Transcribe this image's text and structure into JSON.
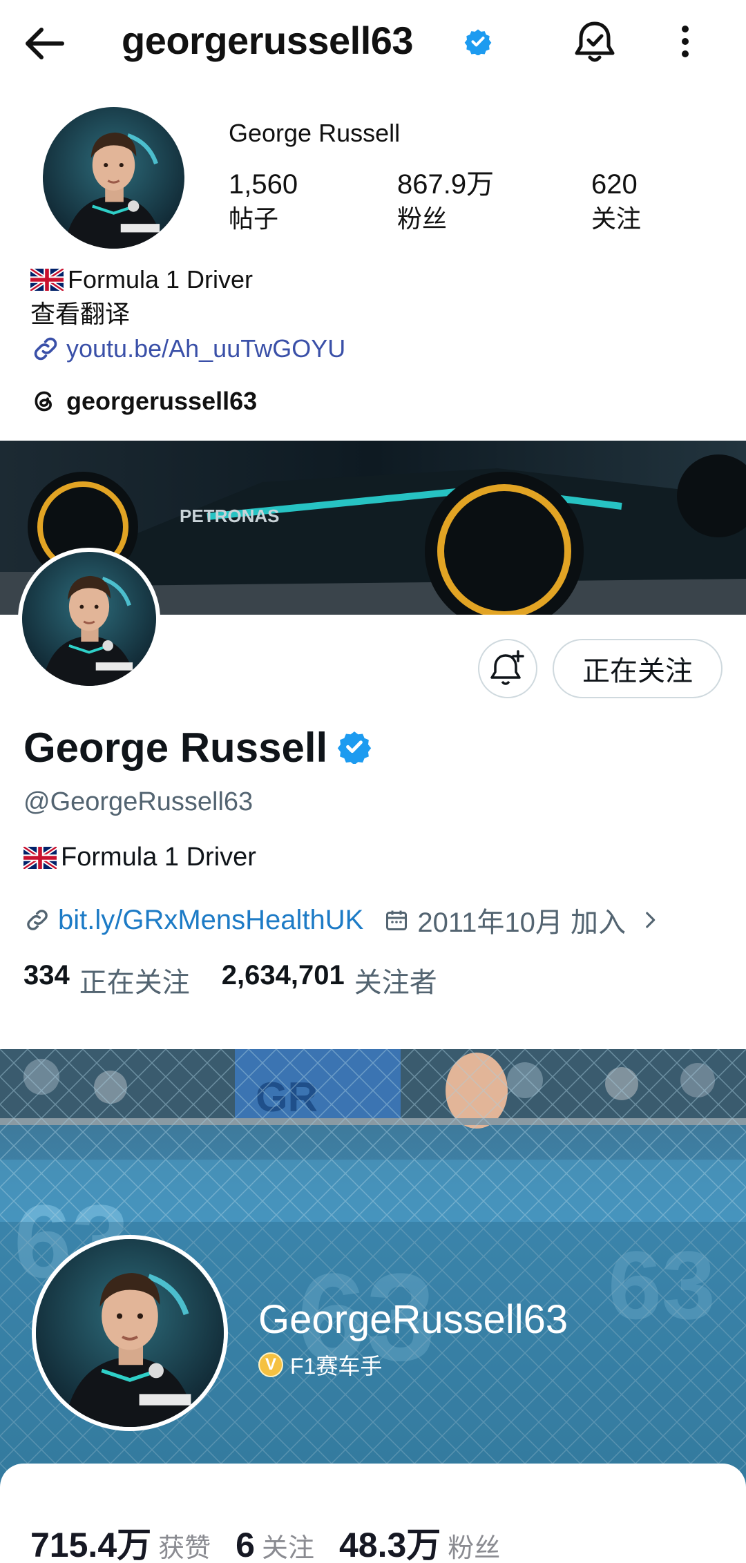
{
  "instagram": {
    "username": "georgerussell63",
    "display_name": "George Russell",
    "stats": [
      {
        "value": "1,560",
        "label": "帖子"
      },
      {
        "value": "867.9万",
        "label": "粉丝"
      },
      {
        "value": "620",
        "label": "关注"
      }
    ],
    "bio": "Formula 1 Driver",
    "translate": "查看翻译",
    "link": "youtu.be/Ah_uuTwGOYU",
    "threads_handle": "georgerussell63"
  },
  "twitter": {
    "follow_button": "正在关注",
    "name": "George Russell",
    "handle": "@GeorgeRussell63",
    "bio": "Formula 1 Driver",
    "link": "bit.ly/GRxMensHealthUK",
    "joined": "2011年10月 加入",
    "following_count": "334",
    "following_label": "正在关注",
    "followers_count": "2,634,701",
    "followers_label": "关注者"
  },
  "douyin": {
    "name": "GeorgeRussell63",
    "role": "F1赛车手",
    "stats": [
      {
        "value": "715.4万",
        "label": "获赞"
      },
      {
        "value": "6",
        "label": "关注"
      },
      {
        "value": "48.3万",
        "label": "粉丝"
      }
    ]
  },
  "colors": {
    "verified_blue": "#1d9bf0",
    "link_blue": "#3a50a8",
    "x_link_blue": "#1d7bc6",
    "gold_badge": "#f5c141"
  }
}
